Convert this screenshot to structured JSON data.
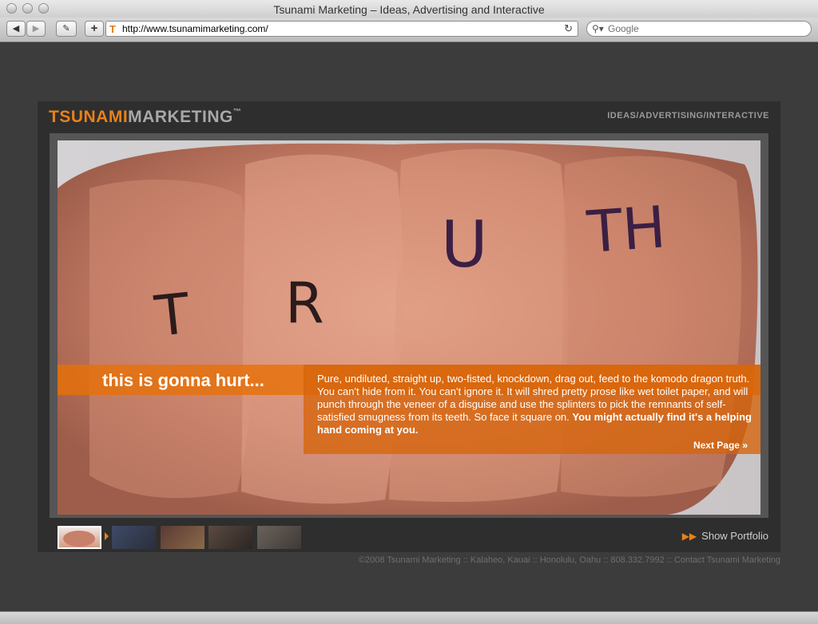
{
  "browser": {
    "window_title": "Tsunami Marketing – Ideas, Advertising and Interactive",
    "url": "http://www.tsunamimarketing.com/",
    "search_placeholder": "Google",
    "icons": [
      "back-arrow-icon",
      "forward-arrow-icon",
      "edit-icon",
      "add-bookmark-icon",
      "favicon-t-icon",
      "reload-icon",
      "search-icon"
    ]
  },
  "site": {
    "logo_part1": "TSUNAMI",
    "logo_part2": "MARKETING",
    "logo_tm": "™",
    "tagline": "IDEAS/ADVERTISING/INTERACTIVE",
    "hero": {
      "headline": "this is gonna hurt...",
      "body": "Pure, undiluted, straight up, two-fisted, knockdown, drag out, feed to the komodo dragon truth. You can't hide from it. You can't ignore it. It will shred pretty prose like wet toilet paper, and will punch through the veneer of a disguise and use the splinters to pick the remnants of self-satisfied smugness from its teeth. So face it square on.",
      "body_bold": "You might actually find it's a helping hand coming at you.",
      "knuckle_letters": [
        "T",
        "R",
        "U",
        "TH"
      ],
      "next_page": "Next Page »"
    },
    "thumbnails": [
      {
        "name": "fist"
      },
      {
        "name": "cyclist"
      },
      {
        "name": "scene-3"
      },
      {
        "name": "face"
      },
      {
        "name": "figure"
      }
    ],
    "show_portfolio": "Show Portfolio",
    "footer": "©2008 Tsunami Marketing :: Kalaheo, Kauai :: Honolulu, Oahu :: 808.332.7992 :: Contact Tsunami Marketing"
  },
  "colors": {
    "brand_orange": "#e8811a",
    "background": "#3c3c3c"
  }
}
